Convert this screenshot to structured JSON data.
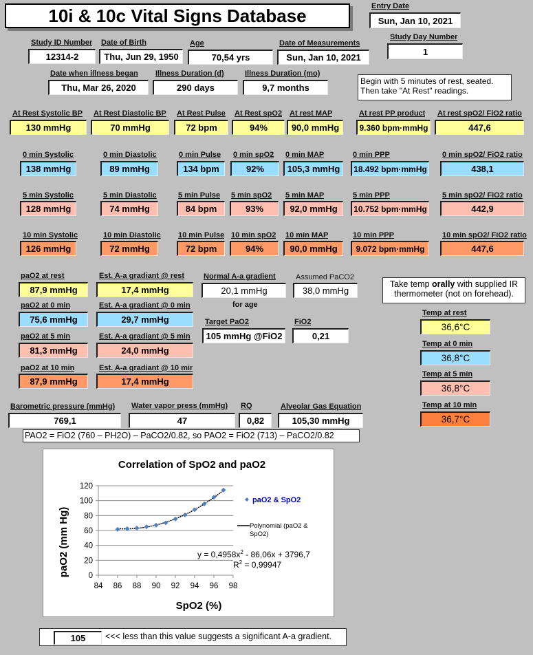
{
  "title": "10i & 10c Vital Signs Database",
  "entry_date": {
    "label": "Entry Date",
    "value": "Sun, Jan 10, 2021"
  },
  "study_day": {
    "label": "Study Day Number",
    "value": "1"
  },
  "study_id": {
    "label": "Study ID Number",
    "value": "12314-2"
  },
  "dob": {
    "label": "Date of Birth",
    "value": "Thu, Jun 29, 1950"
  },
  "age": {
    "label": "Age",
    "value": "70,54 yrs"
  },
  "date_meas": {
    "label": "Date of Measurements",
    "value": "Sun, Jan 10, 2021"
  },
  "illness_began": {
    "label": "Date when illness began",
    "value": "Thu, Mar 26, 2020"
  },
  "illness_d": {
    "label": "Illness Duration (d)",
    "value": "290 days"
  },
  "illness_mo": {
    "label": "Illness Duration (mo)",
    "value": "9,7 months"
  },
  "rest_note": [
    "Begin with 5 minutes of rest, seated.",
    "Then take \"At Rest\" readings."
  ],
  "rows": [
    {
      "key": "rest",
      "labels": [
        "At Rest Systolic BP",
        "At Rest Diastolic BP",
        "At Rest Pulse",
        "At Rest spO2",
        "At rest MAP",
        "At rest PP product",
        "At rest spO2/ FiO2 ratio"
      ],
      "values": [
        "130 mmHg",
        "70 mmHg",
        "72 bpm",
        "94%",
        "90,0 mmHg",
        "9.360 bpm·mmHg",
        "447,6"
      ]
    },
    {
      "key": "0min",
      "labels": [
        "0 min Systolic",
        "0 min Diastolic",
        "0 min Pulse",
        "0 min spO2",
        "0 min MAP",
        "0 min PPP",
        "0 min spO2/ FiO2 ratio"
      ],
      "values": [
        "138 mmHg",
        "89 mmHg",
        "134 bpm",
        "92%",
        "105,3 mmHg",
        "18.492 bpm·mmHg",
        "438,1"
      ]
    },
    {
      "key": "5min",
      "labels": [
        "5 min Systolic",
        "5 min Diastolic",
        "5 min Pulse",
        "5 min spO2",
        "5 min MAP",
        "5 min PPP",
        "5 min spO2/ FiO2 ratio"
      ],
      "values": [
        "128 mmHg",
        "74 mmHg",
        "84 bpm",
        "93%",
        "92,0 mmHg",
        "10.752 bpm·mmHg",
        "442,9"
      ]
    },
    {
      "key": "10min",
      "labels": [
        "10 min Systolic",
        "10 min Diastolic",
        "10 min Pulse",
        "10 min spO2",
        "10 min MAP",
        "10 min PPP",
        "10 min spO2/ FiO2 ratio"
      ],
      "values": [
        "126 mmHg",
        "72 mmHg",
        "72 bpm",
        "94%",
        "90,0 mmHg",
        "9.072 bpm·mmHg",
        "447,6"
      ]
    }
  ],
  "pao2": [
    {
      "label": "paO2 at rest",
      "value": "87,9 mmHg",
      "grad_label": "Est. A-a gradiant @ rest",
      "grad_value": "17,4 mmHg"
    },
    {
      "label": "paO2 at 0 min",
      "value": "75,6 mmHg",
      "grad_label": "Est. A-a gradiant @ 0 min",
      "grad_value": "29,7 mmHg"
    },
    {
      "label": "paO2 at 5 min",
      "value": "81,3 mmHg",
      "grad_label": "Est. A-a gradiant @ 5 min",
      "grad_value": "24,0 mmHg"
    },
    {
      "label": "paO2 at 10 min",
      "value": "87,9 mmHg",
      "grad_label": "Est. A-a gradiant @ 10 min",
      "grad_value": "17,4 mmHg"
    }
  ],
  "normal_aa": {
    "label": "Normal A-a gradient",
    "value": "20,1 mmHg",
    "sub": "for age"
  },
  "assumed_paco2": {
    "label": "Assumed PaCO2",
    "value": "38,0 mmHg"
  },
  "target_pao2": {
    "label": "Target PaO2",
    "value": "105 mmHg @FiO2"
  },
  "fio2": {
    "label": "FiO2",
    "value": "0,21"
  },
  "temp_note": {
    "pre": "Take temp ",
    "bold": "orally",
    "post": " with supplied IR",
    "line2": "thermometer (not on forehead)."
  },
  "temps": [
    {
      "label": "Temp at rest",
      "value": "36,6°C"
    },
    {
      "label": "Temp at 0 min",
      "value": "36,8°C"
    },
    {
      "label": "Temp at 5 min",
      "value": "36,8°C"
    },
    {
      "label": "Temp at 10 min",
      "value": "36,7°C"
    }
  ],
  "baro": {
    "label": "Barometric pressure (mmHg)",
    "value": "769,1"
  },
  "water_vapor": {
    "label": "Water vapor press (mmHg)",
    "value": "47"
  },
  "rq": {
    "label": "RQ",
    "value": "0,82"
  },
  "alveolar": {
    "label": "Alveolar Gas Equation",
    "value": "105,30 mmHg"
  },
  "formula": "PAO2 = FiO2 (760 – PH2O) – PaCO2/0.82, so PAO2 = FiO2 (713) – PaCO2/0.82",
  "threshold": {
    "value": "105",
    "text": "<<< less than this value suggests a significant A-a gradient."
  },
  "colors": {
    "rest": "#ffff99",
    "0min": "#99ddff",
    "5min": "#ffbfb0",
    "10min": "#ff9966",
    "marker": "#4f81bd",
    "legend_text": "#0000cc"
  },
  "chart_data": {
    "type": "scatter",
    "title": "Correlation of SpO2 and paO2",
    "xlabel": "SpO2 (%)",
    "ylabel": "paO2 (mm Hg)",
    "xlim": [
      84,
      98
    ],
    "ylim": [
      0,
      120
    ],
    "xticks": [
      84,
      86,
      88,
      90,
      92,
      94,
      96,
      98
    ],
    "yticks": [
      0,
      20,
      40,
      60,
      80,
      100,
      120
    ],
    "grid": "horizontal",
    "legend": "right",
    "series": [
      {
        "name": "paO2 & SpO2",
        "x": [
          86,
          87,
          88,
          89,
          90,
          91,
          92,
          93,
          94,
          95,
          96,
          97
        ],
        "y": [
          61.5,
          62.3,
          63.2,
          65.0,
          67.1,
          70.3,
          75.4,
          80.8,
          87.9,
          95.6,
          104.6,
          114.2
        ]
      }
    ],
    "trendline": {
      "name": "Polynomial (paO2 & SpO2)",
      "line1": "(paO2 &",
      "line2": "SpO2)",
      "label_head": "Polynomial",
      "coefficients": [
        0.4958,
        -86.06,
        3796.7
      ],
      "equation": "y = 0,4958x",
      "equation_tail": " - 86,06x + 3796,7",
      "r2": "= 0,99947"
    }
  }
}
